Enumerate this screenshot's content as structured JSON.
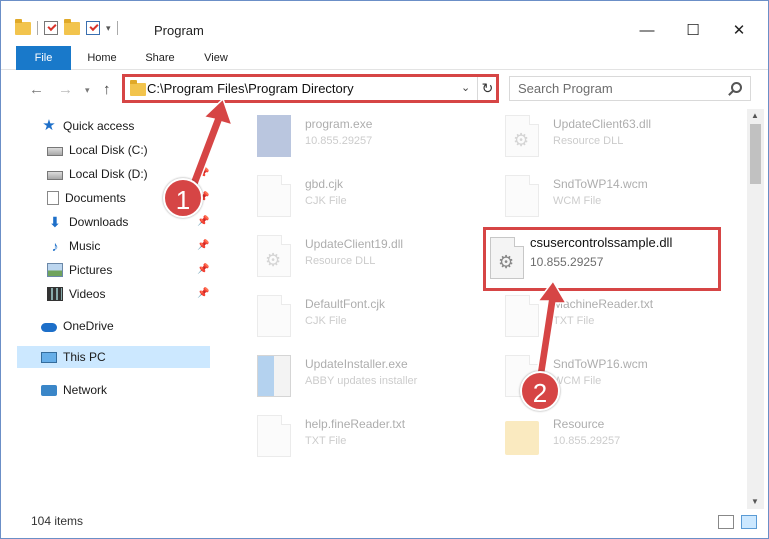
{
  "window": {
    "title": "Program",
    "controls": {
      "minimize": "—",
      "maximize": "☐",
      "close": "✕"
    }
  },
  "ribbon": {
    "tabs": [
      {
        "label": "File",
        "active": true
      },
      {
        "label": "Home"
      },
      {
        "label": "Share"
      },
      {
        "label": "View"
      }
    ]
  },
  "address_bar": {
    "path": "C:\\Program Files\\Program Directory",
    "refresh_icon": "refresh-icon"
  },
  "search": {
    "placeholder": "Search Program"
  },
  "nav_pane": {
    "items": [
      {
        "label": "Quick access",
        "icon": "star-icon",
        "pinned": false
      },
      {
        "label": "Local Disk (C:)",
        "icon": "disk-icon",
        "pinned": false
      },
      {
        "label": "Local Disk (D:)",
        "icon": "disk-icon",
        "pinned": true
      },
      {
        "label": "Documents",
        "icon": "documents-icon",
        "pinned": true
      },
      {
        "label": "Downloads",
        "icon": "downloads-icon",
        "pinned": true
      },
      {
        "label": "Music",
        "icon": "music-icon",
        "pinned": true
      },
      {
        "label": "Pictures",
        "icon": "pictures-icon",
        "pinned": true
      },
      {
        "label": "Videos",
        "icon": "videos-icon",
        "pinned": true
      },
      {
        "label": "OneDrive",
        "icon": "onedrive-icon",
        "pinned": false
      },
      {
        "label": "This PC",
        "icon": "pc-icon",
        "pinned": false,
        "selected": true
      },
      {
        "label": "Network",
        "icon": "network-icon",
        "pinned": false
      }
    ]
  },
  "files": [
    {
      "name": "program.exe",
      "detail": "10.855.29257",
      "type": "exe"
    },
    {
      "name": "UpdateClient63.dll",
      "detail": "Resource DLL",
      "type": "dll"
    },
    {
      "name": "gbd.cjk",
      "detail": "CJK File",
      "type": "file"
    },
    {
      "name": "SndToWP14.wcm",
      "detail": "WCM File",
      "type": "file"
    },
    {
      "name": "UpdateClient19.dll",
      "detail": "Resource DLL",
      "type": "dll"
    },
    {
      "name": "DefaultFont.cjk",
      "detail": "CJK File",
      "type": "file"
    },
    {
      "name": "MachineReader.txt",
      "detail": "TXT File",
      "type": "file"
    },
    {
      "name": "UpdateInstaller.exe",
      "detail": "ABBY updates installer",
      "type": "installer"
    },
    {
      "name": "SndToWP16.wcm",
      "detail": "WCM File",
      "type": "file"
    },
    {
      "name": "help.fineReader.txt",
      "detail": "TXT File",
      "type": "file"
    },
    {
      "name": "Resource",
      "detail": "10.855.29257",
      "type": "folder"
    }
  ],
  "highlighted_file": {
    "name": "csusercontrolssample.dll",
    "detail": "10.855.29257"
  },
  "status_bar": {
    "item_count": "104 items"
  },
  "annotations": {
    "callout_1": "1",
    "callout_2": "2",
    "color": "#d64545"
  }
}
